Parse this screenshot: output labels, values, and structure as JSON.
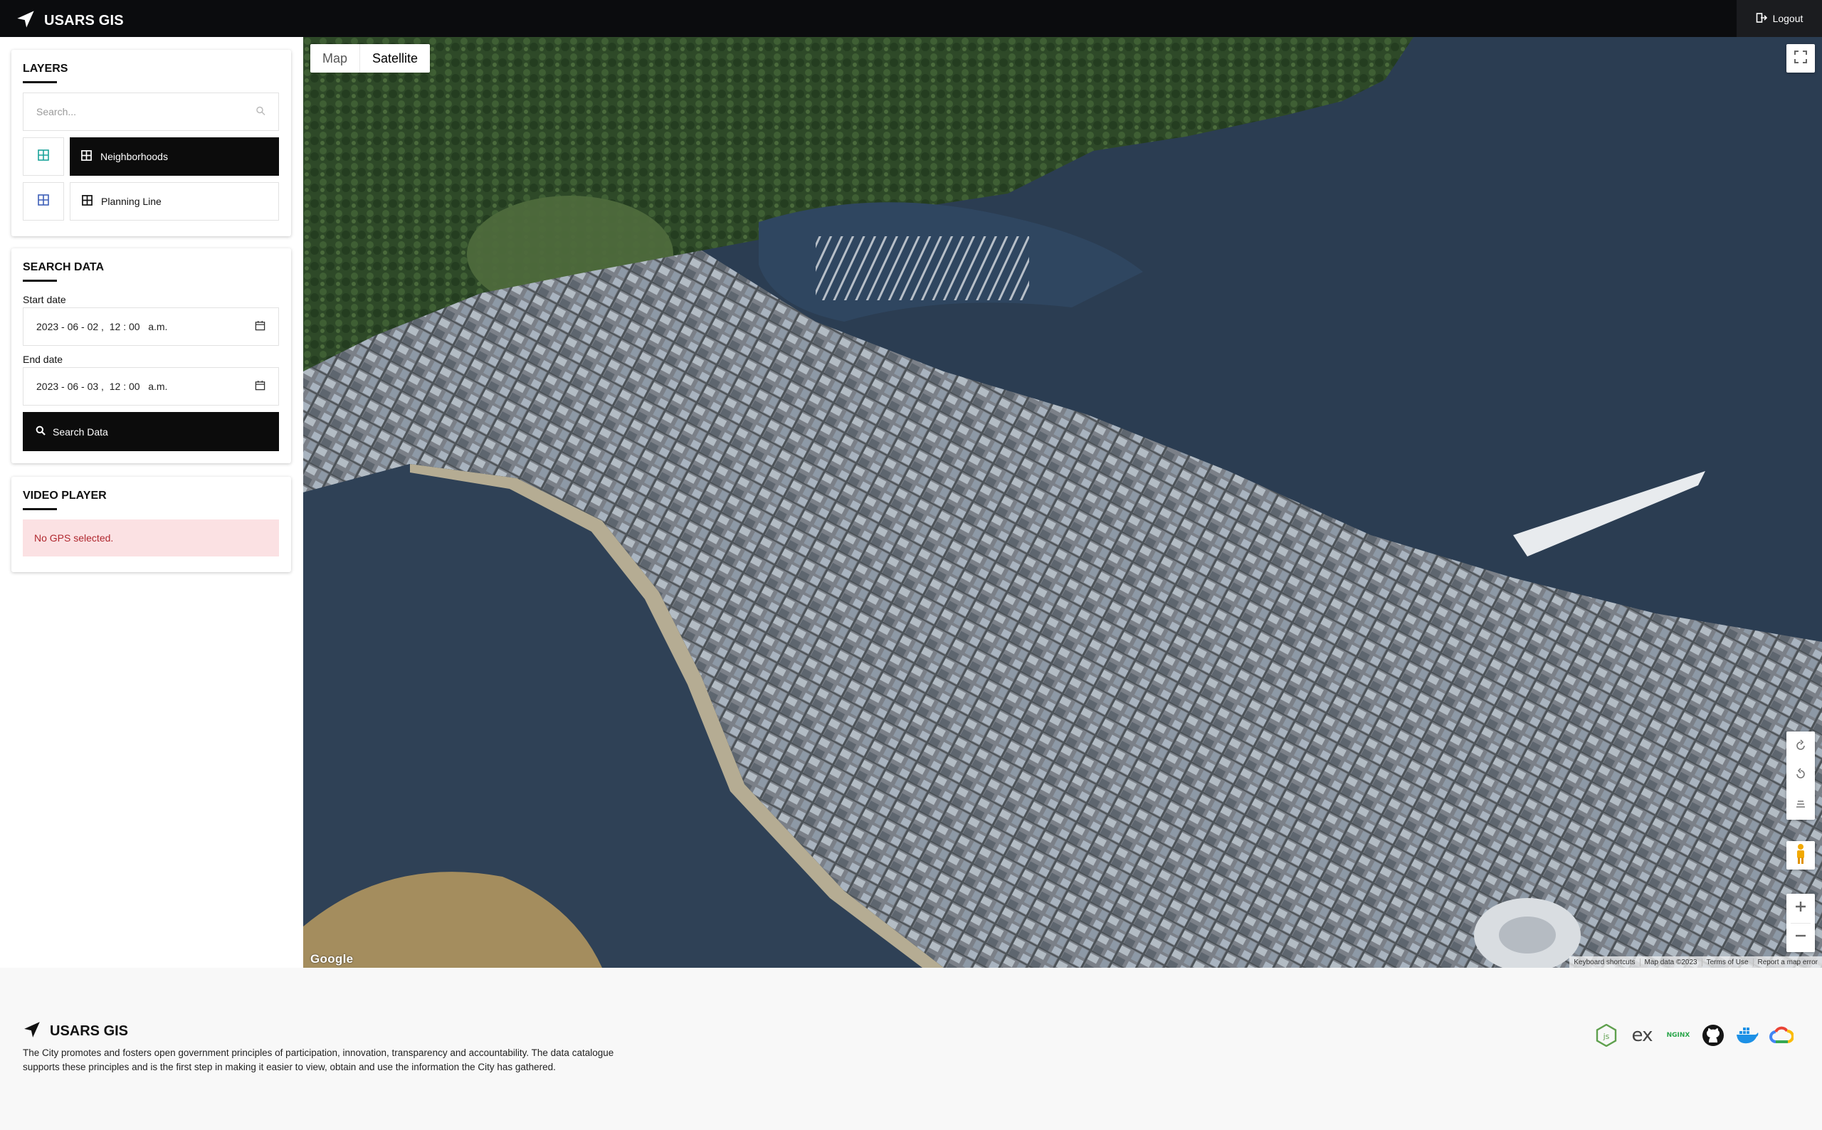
{
  "app": {
    "name": "USARS GIS",
    "logout_label": "Logout"
  },
  "layers": {
    "title": "LAYERS",
    "search_placeholder": "Search...",
    "items": [
      {
        "label": "Neighborhoods",
        "active": true,
        "toggle_color": "#1aa39a"
      },
      {
        "label": "Planning Line",
        "active": false,
        "toggle_color": "#3e5fb8"
      }
    ]
  },
  "search_data": {
    "title": "SEARCH DATA",
    "start_label": "Start date",
    "start_value": "2023 - 06 - 02 ,  12 : 00   a.m.",
    "end_label": "End date",
    "end_value": "2023 - 06 - 03 ,  12 : 00   a.m.",
    "button_label": "Search Data"
  },
  "video_player": {
    "title": "VIDEO PLAYER",
    "message": "No GPS selected."
  },
  "map": {
    "type_options": [
      "Map",
      "Satellite"
    ],
    "selected_type": "Satellite",
    "google_label": "Google",
    "attribution": [
      "Keyboard shortcuts",
      "Map data ©2023",
      "Terms of Use",
      "Report a map error"
    ],
    "icons": [
      "fullscreen-icon",
      "rotate-clockwise-icon",
      "rotate-counterclockwise-icon",
      "tilt-icon",
      "pegman-icon",
      "zoom-in-icon",
      "zoom-out-icon"
    ]
  },
  "footer": {
    "name": "USARS GIS",
    "description": "The City promotes and fosters open government principles of participation, innovation, transparency and accountability. The data catalogue supports these principles and is the first step in making it easier to view, obtain and use the information the City has gathered.",
    "tech_icons": [
      "nodejs-icon",
      "express-icon",
      "nginx-icon",
      "github-icon",
      "docker-icon",
      "google-cloud-icon"
    ],
    "tech_labels": {
      "express": "ex",
      "nginx": "NGINX"
    }
  },
  "colors": {
    "topbar": "#0b0c0e",
    "primary_button": "#0c0c0c",
    "alert_bg": "#fbe1e3",
    "alert_text": "#b0282f",
    "water": "#2b3d52",
    "forest": "#2f4a2a"
  }
}
